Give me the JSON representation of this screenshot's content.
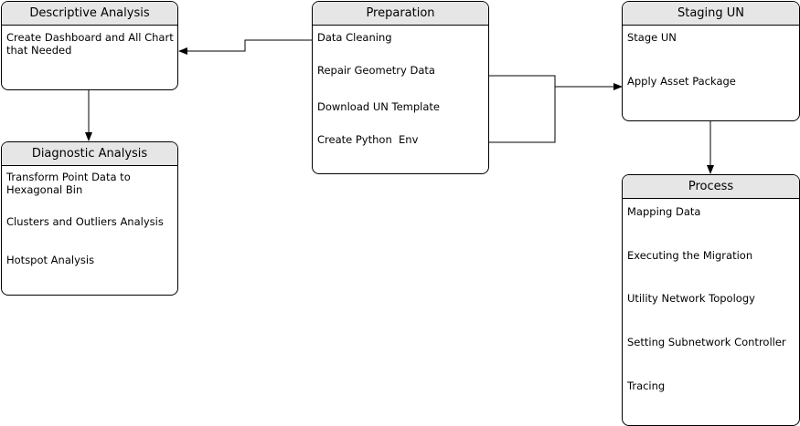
{
  "descriptive": {
    "title": "Descriptive Analysis",
    "items": [
      "Create Dashboard and All Chart that Needed"
    ]
  },
  "diagnostic": {
    "title": "Diagnostic Analysis",
    "items": [
      "Transform Point Data to Hexagonal Bin",
      "Clusters and Outliers Analysis",
      "Hotspot Analysis"
    ]
  },
  "preparation": {
    "title": "Preparation",
    "items": [
      "Data Cleaning",
      "Repair Geometry Data",
      "Download UN Template",
      "Create Python  Env"
    ]
  },
  "staging": {
    "title": "Staging UN",
    "items": [
      "Stage UN",
      "Apply Asset Package"
    ]
  },
  "process": {
    "title": "Process",
    "items": [
      "Mapping Data",
      "Executing the Migration",
      "Utility Network Topology",
      "Setting Subnetwork Controller",
      "Tracing"
    ]
  }
}
